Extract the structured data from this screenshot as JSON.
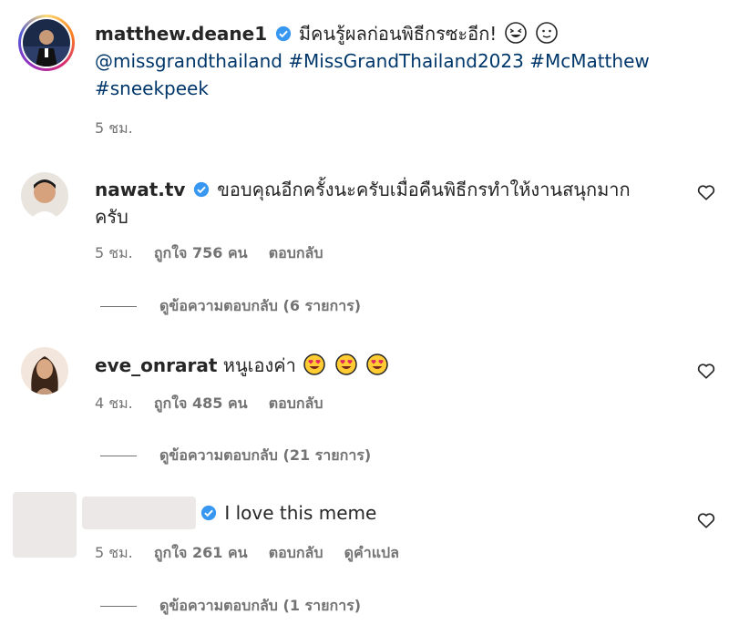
{
  "post": {
    "username": "matthew.deane1",
    "caption": "มีคนรู้ผลก่อนพิธีกรซะอีก!",
    "hashtags_line1": "@missgrandthailand #MissGrandThailand2023 #McMatthew",
    "hashtags_line2": "#sneekpeek",
    "time": "5 ชม."
  },
  "comments": [
    {
      "username": "nawat.tv",
      "text_line1": "ขอบคุณอีกครั้งนะครับเมื่อคืนพิธีกรทำให้งานสนุกมาก",
      "text_line2": "ครับ",
      "time": "5 ชม.",
      "likes": "ถูกใจ 756 คน",
      "reply": "ตอบกลับ",
      "view_replies": "ดูข้อความตอบกลับ (6 รายการ)"
    },
    {
      "username": "eve_onrarat",
      "text": "หนูเองค่า",
      "time": "4 ชม.",
      "likes": "ถูกใจ 485 คน",
      "reply": "ตอบกลับ",
      "view_replies": "ดูข้อความตอบกลับ (21 รายการ)"
    },
    {
      "text": "I love this meme",
      "time": "5 ชม.",
      "likes": "ถูกใจ 261 คน",
      "reply": "ตอบกลับ",
      "translate": "ดูคำแปล",
      "view_replies": "ดูข้อความตอบกลับ (1 รายการ)"
    }
  ],
  "colors": {
    "text": "#262626",
    "secondary": "#737373",
    "link": "#00376b",
    "verified": "#3897f0"
  }
}
